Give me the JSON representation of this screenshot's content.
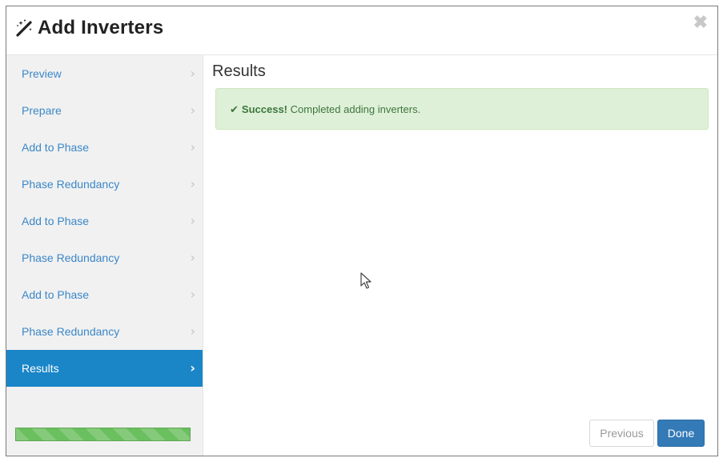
{
  "dialog": {
    "title": "Add Inverters",
    "close_symbol": "✖",
    "title_icon": "magic-wand-icon"
  },
  "sidebar": {
    "items": [
      {
        "label": "Preview",
        "active": false
      },
      {
        "label": "Prepare",
        "active": false
      },
      {
        "label": "Add to Phase",
        "active": false
      },
      {
        "label": "Phase Redundancy",
        "active": false
      },
      {
        "label": "Add to Phase",
        "active": false
      },
      {
        "label": "Phase Redundancy",
        "active": false
      },
      {
        "label": "Add to Phase",
        "active": false
      },
      {
        "label": "Phase Redundancy",
        "active": false
      },
      {
        "label": "Results",
        "active": true
      }
    ],
    "chevron": "›",
    "progress": {
      "percent": 100,
      "color": "#6abf5e"
    }
  },
  "main": {
    "heading": "Results",
    "alert": {
      "check": "✔",
      "strong": "Success!",
      "message": "Completed adding inverters."
    }
  },
  "footer": {
    "previous_label": "Previous",
    "done_label": "Done"
  },
  "colors": {
    "accent": "#1a86c8",
    "primary_button": "#337ab7",
    "success_bg": "#dff0d8",
    "success_text": "#3c763d",
    "link": "#3a87c8"
  }
}
